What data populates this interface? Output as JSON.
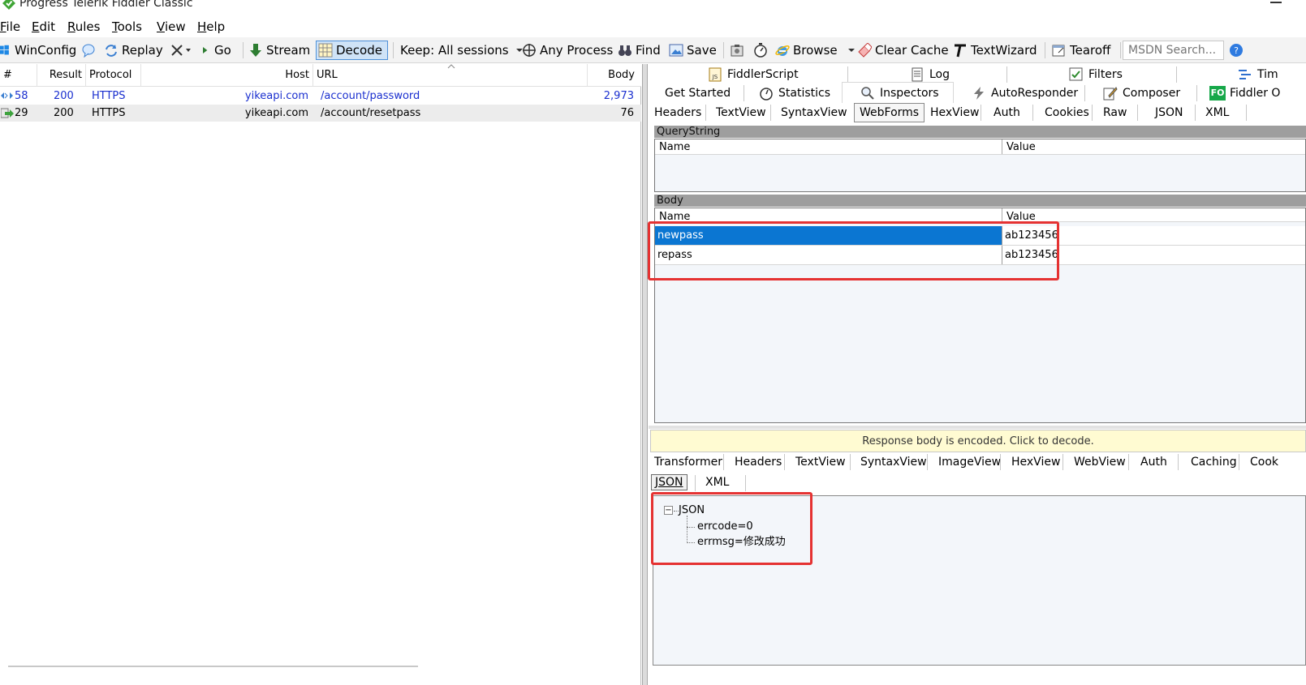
{
  "window": {
    "title": "Progress Telerik Fiddler Classic"
  },
  "menu": [
    {
      "label": "File",
      "ul": "F",
      "rest": "ile"
    },
    {
      "label": "Edit",
      "ul": "E",
      "rest": "dit"
    },
    {
      "label": "Rules",
      "ul": "R",
      "rest": "ules"
    },
    {
      "label": "Tools",
      "ul": "T",
      "rest": "ools"
    },
    {
      "label": "View",
      "ul": "V",
      "rest": "iew"
    },
    {
      "label": "Help",
      "ul": "H",
      "rest": "elp"
    }
  ],
  "toolbar": {
    "winconfig": "WinConfig",
    "replay": "Replay",
    "go": "Go",
    "stream": "Stream",
    "decode": "Decode",
    "keep": "Keep: All sessions",
    "any_process": "Any Process",
    "find": "Find",
    "save": "Save",
    "browse": "Browse",
    "clear_cache": "Clear Cache",
    "textwizard": "TextWizard",
    "tearoff": "Tearoff",
    "msdn_placeholder": "MSDN Search..."
  },
  "sessions": {
    "columns": [
      "#",
      "Result",
      "Protocol",
      "Host",
      "URL",
      "Body"
    ],
    "rows": [
      {
        "id": "58",
        "result": "200",
        "protocol": "HTTPS",
        "host": "yikeapi.com",
        "url": "/account/password",
        "body": "2,973"
      },
      {
        "id": "29",
        "result": "200",
        "protocol": "HTTPS",
        "host": "yikeapi.com",
        "url": "/account/resetpass",
        "body": "76"
      }
    ]
  },
  "top_tabs": {
    "row1": [
      "FiddlerScript",
      "Log",
      "Filters",
      "Tim"
    ],
    "row2": [
      "Get Started",
      "Statistics",
      "Inspectors",
      "AutoResponder",
      "Composer",
      "Fiddler O"
    ],
    "fo_badge": "FO"
  },
  "request_tabs": [
    "Headers",
    "TextView",
    "SyntaxView",
    "WebForms",
    "HexView",
    "Auth",
    "Cookies",
    "Raw",
    "JSON",
    "XML"
  ],
  "querystring": {
    "title": "QueryString",
    "col_name": "Name",
    "col_value": "Value"
  },
  "body": {
    "title": "Body",
    "col_name": "Name",
    "col_value": "Value",
    "rows": [
      {
        "name": "newpass",
        "value": "ab123456"
      },
      {
        "name": "repass",
        "value": "ab123456"
      }
    ]
  },
  "response": {
    "banner": "Response body is encoded. Click to decode.",
    "tabs": [
      "Transformer",
      "Headers",
      "TextView",
      "SyntaxView",
      "ImageView",
      "HexView",
      "WebView",
      "Auth",
      "Caching",
      "Cook"
    ],
    "subtabs": [
      "JSON",
      "XML"
    ],
    "tree": {
      "root": "JSON",
      "expander": "−",
      "children": [
        "errcode=0",
        "errmsg=修改成功"
      ]
    }
  },
  "colors": {
    "accent": "#0b76d2",
    "highlight": "#e53232",
    "banner": "#fffbd2"
  }
}
